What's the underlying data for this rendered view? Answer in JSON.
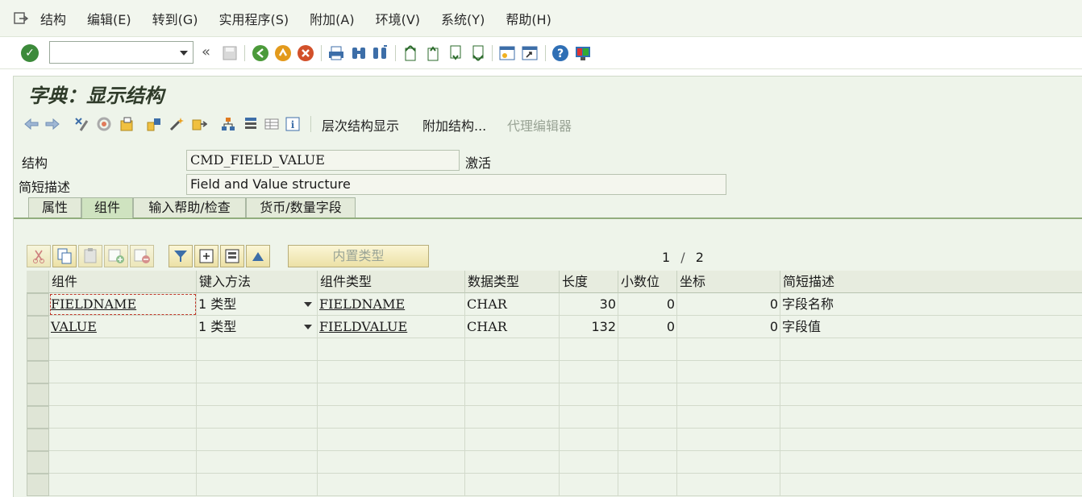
{
  "menu": [
    "结构",
    "编辑(E)",
    "转到(G)",
    "实用程序(S)",
    "附加(A)",
    "环境(V)",
    "系统(Y)",
    "帮助(H)"
  ],
  "command_field": {
    "value": ""
  },
  "back_symbol": "«",
  "screen_title": "字典：显示结构",
  "app_toolbar": {
    "hierarchy_btn": "层次结构显示",
    "append_btn": "附加结构...",
    "proxy_btn": "代理编辑器"
  },
  "header": {
    "struct_label": "结构",
    "struct_value": "CMD_FIELD_VALUE",
    "status": "激活",
    "desc_label": "简短描述",
    "desc_value": "Field and Value structure"
  },
  "tabs": [
    "属性",
    "组件",
    "输入帮助/检查",
    "货币/数量字段"
  ],
  "active_tab": 1,
  "grid_toolbar": {
    "builtin_type": "内置类型",
    "page_current": "1",
    "page_sep": "/",
    "page_total": "2"
  },
  "table": {
    "columns": [
      "组件",
      "键入方法",
      "组件类型",
      "数据类型",
      "长度",
      "小数位",
      "坐标",
      "简短描述"
    ],
    "rows": [
      {
        "component": "FIELDNAME",
        "typing_method": "1 类型",
        "component_type": "FIELDNAME",
        "data_type": "CHAR",
        "length": "30",
        "decimals": "0",
        "coordinate": "0",
        "description": "字段名称"
      },
      {
        "component": "VALUE",
        "typing_method": "1 类型",
        "component_type": "FIELDVALUE",
        "data_type": "CHAR",
        "length": "132",
        "decimals": "0",
        "coordinate": "0",
        "description": "字段值"
      }
    ]
  },
  "colors": {
    "panel_bg": "#eef4ea",
    "tab_active": "#cfe3c0",
    "enter_green": "#3c8a3a",
    "button_yellow": "#ece1a6"
  }
}
